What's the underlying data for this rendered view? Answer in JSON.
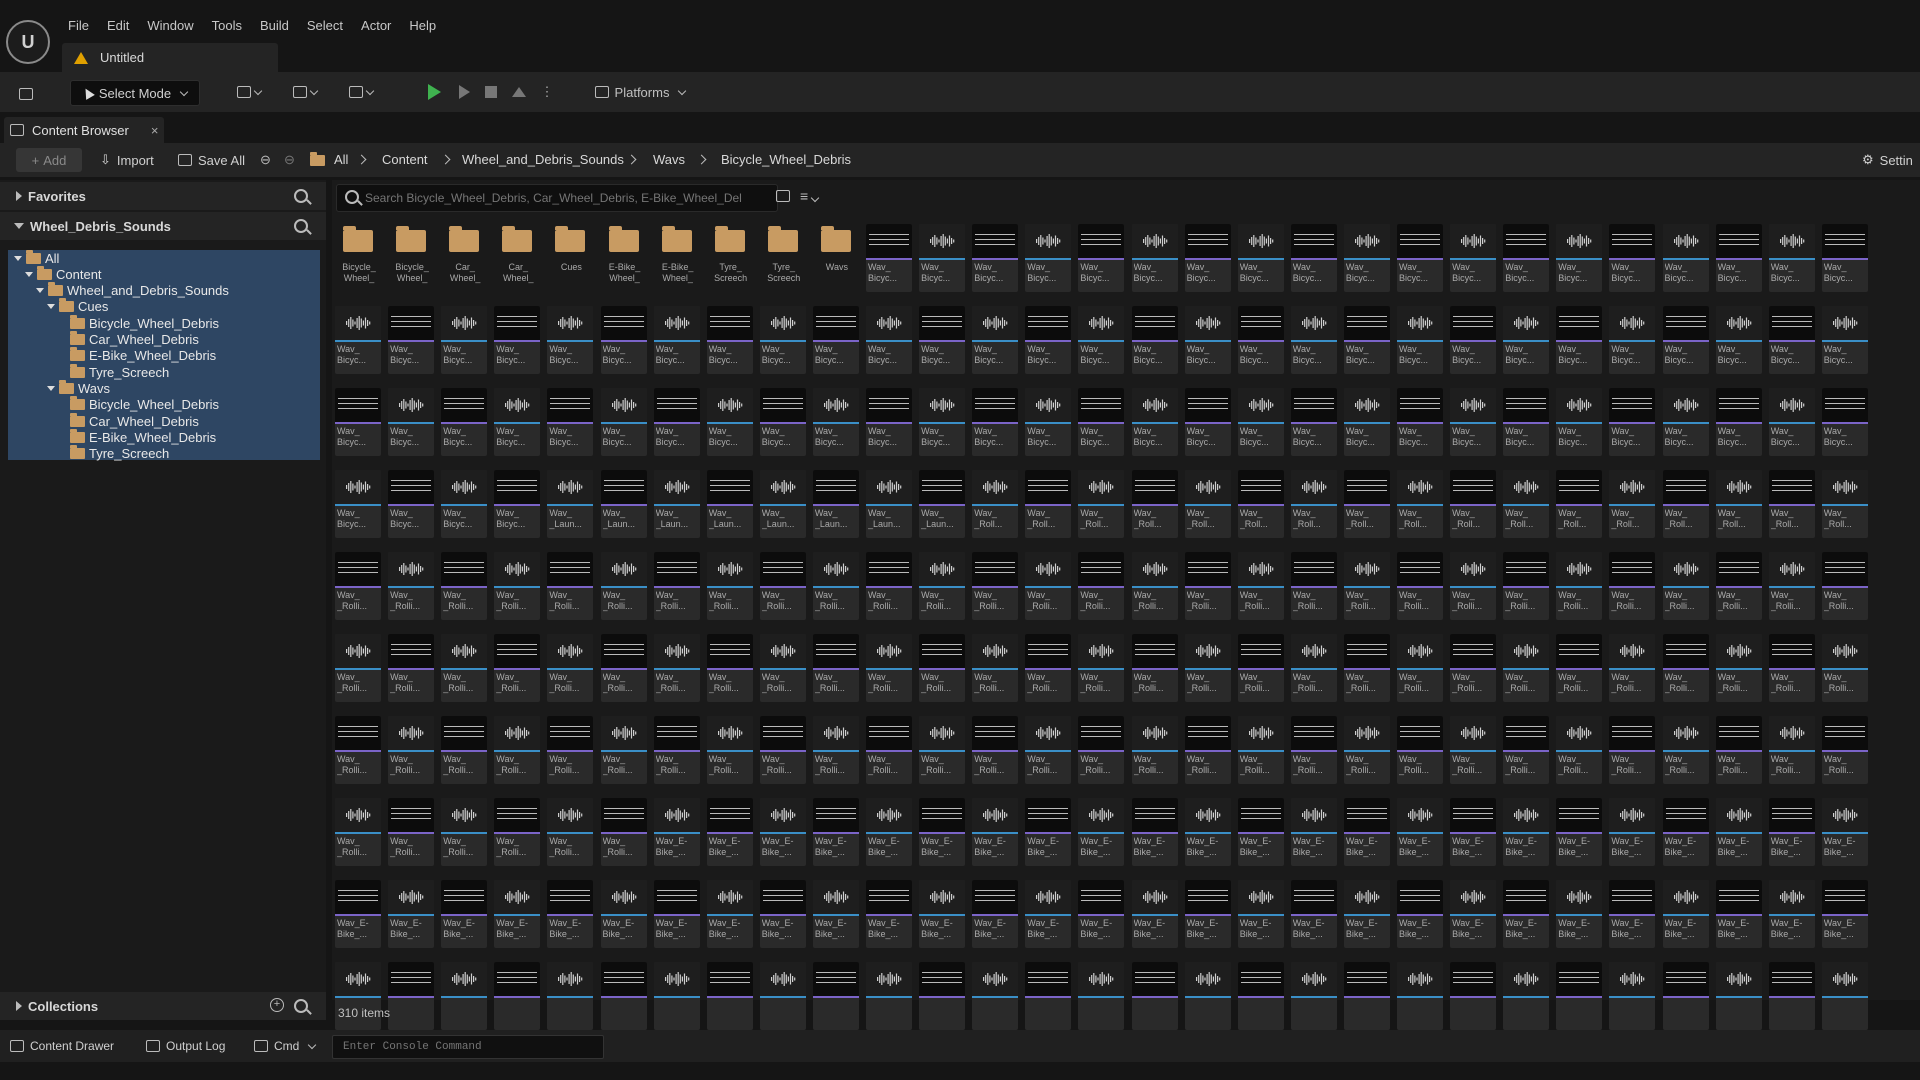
{
  "menubar": {
    "items": [
      "File",
      "Edit",
      "Window",
      "Tools",
      "Build",
      "Select",
      "Actor",
      "Help"
    ]
  },
  "document_tab": {
    "title": "Untitled"
  },
  "toolbar": {
    "select_mode_label": "Select Mode",
    "platforms_label": "Platforms"
  },
  "content_browser_tab": {
    "title": "Content Browser",
    "close": "×"
  },
  "navbar": {
    "add_label": "Add",
    "import_label": "Import",
    "save_all_label": "Save All",
    "breadcrumbs": [
      "All",
      "Content",
      "Wheel_and_Debris_Sounds",
      "Wavs",
      "Bicycle_Wheel_Debris"
    ],
    "settings_label": "Settin"
  },
  "left_panel": {
    "favorites_label": "Favorites",
    "project_label": "Wheel_Debris_Sounds",
    "tree": [
      {
        "label": "All",
        "depth": 0
      },
      {
        "label": "Content",
        "depth": 1
      },
      {
        "label": "Wheel_and_Debris_Sounds",
        "depth": 2
      },
      {
        "label": "Cues",
        "depth": 3
      },
      {
        "label": "Bicycle_Wheel_Debris",
        "depth": 4
      },
      {
        "label": "Car_Wheel_Debris",
        "depth": 4
      },
      {
        "label": "E-Bike_Wheel_Debris",
        "depth": 4
      },
      {
        "label": "Tyre_Screech",
        "depth": 4
      },
      {
        "label": "Wavs",
        "depth": 3
      },
      {
        "label": "Bicycle_Wheel_Debris",
        "depth": 4
      },
      {
        "label": "Car_Wheel_Debris",
        "depth": 4
      },
      {
        "label": "E-Bike_Wheel_Debris",
        "depth": 4
      },
      {
        "label": "Tyre_Screech",
        "depth": 4
      }
    ],
    "collections_label": "Collections"
  },
  "search": {
    "placeholder": "Search Bicycle_Wheel_Debris, Car_Wheel_Debris, E-Bike_Wheel_Del"
  },
  "folder_tiles": [
    "Bicycle_\nWheel_",
    "Bicycle_\nWheel_",
    "Car_\nWheel_",
    "Car_\nWheel_",
    "Cues",
    "E-Bike_\nWheel_",
    "E-Bike_\nWheel_",
    "Tyre_\nScreech",
    "Tyre_\nScreech",
    "Wavs"
  ],
  "asset_rows": [
    {
      "caption": "Wav_\nBicyc..."
    },
    {
      "caption": "Wav_\nBicyc..."
    },
    {
      "caption": "Wav_\nBicyc..."
    },
    {
      "caption": "Wav_\n_Roll..."
    },
    {
      "caption": "Wav_\n_Rolli..."
    },
    {
      "caption": "Wav_\n_Rolli..."
    },
    {
      "caption": "Wav_\n_Rolli..."
    },
    {
      "caption": "Wav_E-\nBike_..."
    },
    {
      "caption": "Wav_E-\nBike_..."
    }
  ],
  "row4_captions": [
    "Wav_\nBicyc...",
    "Wav_\nBicyc...",
    "Wav_\nBicyc...",
    "Wav_\nBicyc...",
    "Wav_\n_Laun...",
    "Wav_\n_Laun...",
    "Wav_\n_Laun...",
    "Wav_\n_Laun...",
    "Wav_\n_Laun...",
    "Wav_\n_Laun...",
    "Wav_\n_Laun...",
    "Wav_\n_Laun..."
  ],
  "row8_captions": [
    "Wav_\n_Rolli...",
    "Wav_\n_Rolli...",
    "Wav_\n_Rolli...",
    "Wav_\n_Rolli...",
    "Wav_\n_Rolli...",
    "Wav_\n_Rolli..."
  ],
  "item_count": "310 items",
  "bottom_bar": {
    "content_drawer": "Content Drawer",
    "output_log": "Output Log",
    "cmd": "Cmd",
    "console_placeholder": "Enter Console Command"
  }
}
